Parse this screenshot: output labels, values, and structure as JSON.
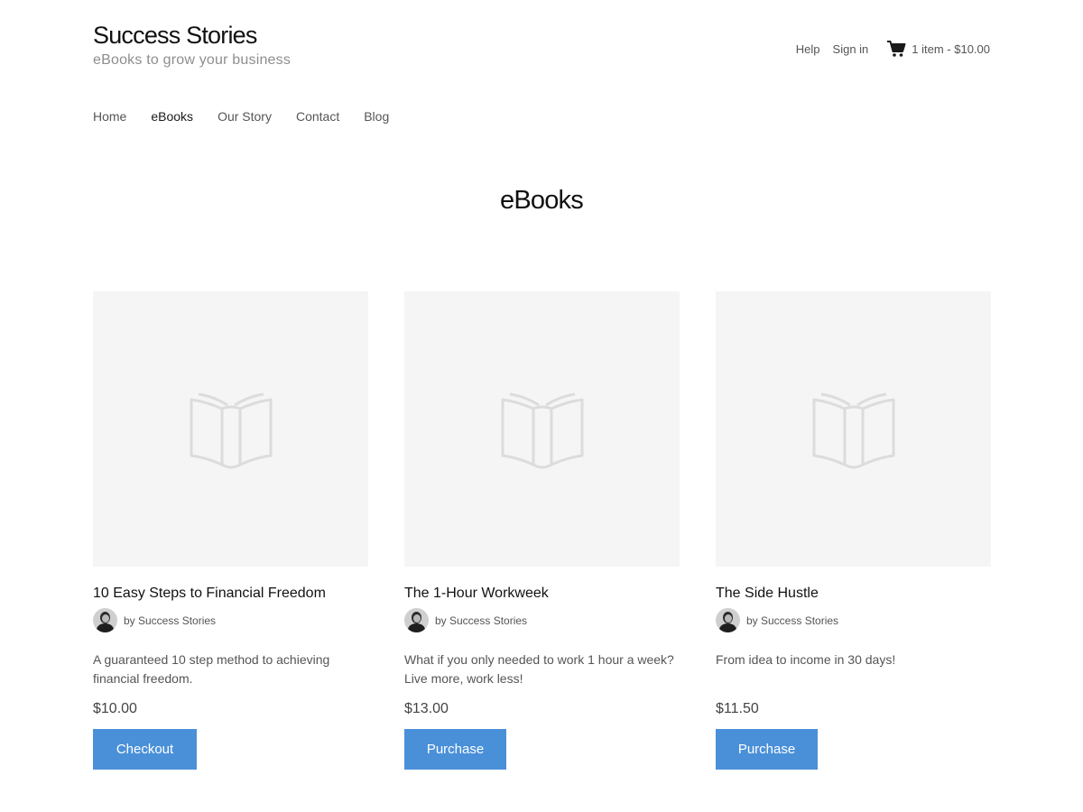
{
  "site": {
    "title": "Success Stories",
    "tagline": "eBooks to grow your business"
  },
  "top_links": {
    "help": "Help",
    "sign_in": "Sign in",
    "cart_icon": "shopping-cart-icon",
    "cart_summary": "1 item - $10.00"
  },
  "nav": {
    "items": [
      "Home",
      "eBooks",
      "Our Story",
      "Contact",
      "Blog"
    ],
    "active": "eBooks"
  },
  "page": {
    "title": "eBooks"
  },
  "products": [
    {
      "name": "10 Easy Steps to Financial Freedom",
      "author": "by Success Stories",
      "description": "A guaranteed 10 step method to achieving financial freedom.",
      "price": "$10.00",
      "button": "Checkout",
      "image_icon": "open-book-icon"
    },
    {
      "name": "The 1-Hour Workweek",
      "author": "by Success Stories",
      "description": "What if you only needed to work 1 hour a week? Live more, work less!",
      "price": "$13.00",
      "button": "Purchase",
      "image_icon": "open-book-icon"
    },
    {
      "name": "The Side Hustle",
      "author": "by Success Stories",
      "description": "From idea to income in 30 days!",
      "price": "$11.50",
      "button": "Purchase",
      "image_icon": "open-book-icon"
    }
  ],
  "colors": {
    "accent": "#4a90d9",
    "placeholder_bg": "#f5f5f5",
    "muted_text": "#8e8e8e"
  }
}
